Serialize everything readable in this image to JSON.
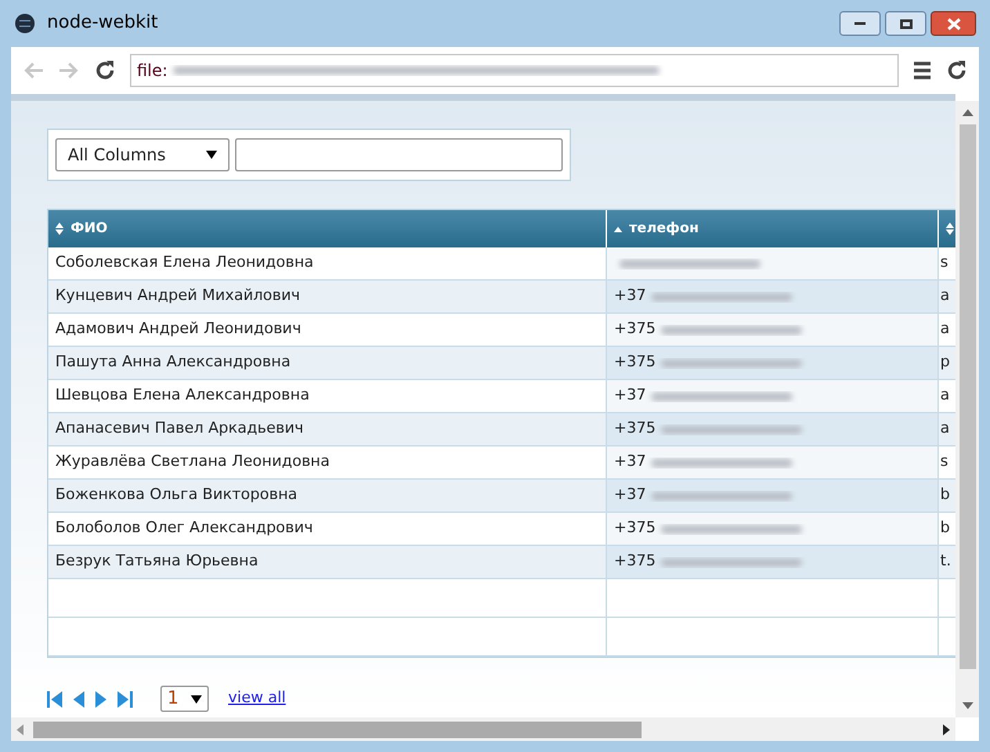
{
  "window": {
    "title": "node-webkit"
  },
  "address_bar": {
    "value": "file:"
  },
  "filter": {
    "column_select": "All Columns"
  },
  "table": {
    "columns": [
      {
        "label": "ФИО",
        "sorted": false
      },
      {
        "label": "телефон",
        "sorted": true
      },
      {
        "sorted": false
      }
    ],
    "rows": [
      {
        "name": "Соболевская Елена Леонидовна",
        "phone": "",
        "column_3": "s"
      },
      {
        "name": "Кунцевич Андрей Михайлович",
        "phone": "+37",
        "column_3": "a"
      },
      {
        "name": "Адамович Андрей Леонидович",
        "phone": "+375",
        "column_3": "a"
      },
      {
        "name": "Пашута Анна Александровна",
        "phone": "+375",
        "column_3": "p"
      },
      {
        "name": "Шевцова Елена Александровна",
        "phone": "+37",
        "column_3": "a"
      },
      {
        "name": "Апанасевич Павел Аркадьевич",
        "phone": "+375",
        "column_3": "a"
      },
      {
        "name": "Журавлёва Светлана Леонидовна",
        "phone": "+37",
        "column_3": "s"
      },
      {
        "name": "Боженкова Ольга Викторовна",
        "phone": "+37",
        "column_3": "b"
      },
      {
        "name": "Болоболов Олег Александрович",
        "phone": "+375",
        "column_3": "b"
      },
      {
        "name": "Безрук Татьяна Юрьевна",
        "phone": "+375",
        "column_3": "t."
      }
    ]
  },
  "pager": {
    "page": "1",
    "view_all": "view all"
  }
}
